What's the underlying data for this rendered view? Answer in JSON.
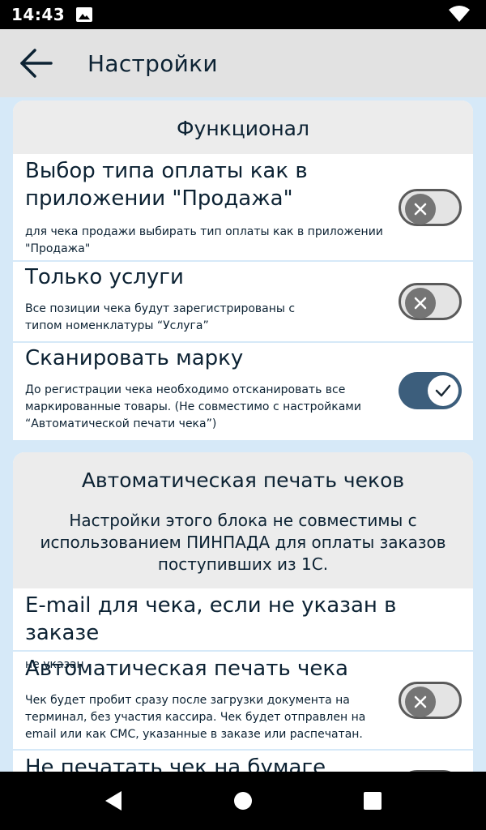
{
  "status": {
    "time": "14:43"
  },
  "app_bar": {
    "title": "Настройки"
  },
  "card1": {
    "title": "Функционал",
    "rows": [
      {
        "title": "Выбор типа оплаты как в приложении \"Продажа\"",
        "desc": "для чека продажи выбирать тип оплаты как в приложении \"Продажа\"",
        "enabled": false
      },
      {
        "title": "Только услуги",
        "desc": "Все позиции чека будут зарегистрированы с типом номенклатуры “Услуга”",
        "enabled": false
      },
      {
        "title": "Сканировать марку",
        "desc": "До регистрации чека необходимо отсканировать все маркированные товары. (Не совместимо с настройками “Автоматической печати чека”)",
        "enabled": true
      }
    ]
  },
  "card2": {
    "title": "Автоматическая печать чеков",
    "note": "Настройки этого блока не совместимы с использованием ПИНПАДА для оплаты заказов поступивших из 1С.",
    "rows": [
      {
        "title": "E-mail для чека, если не указан в заказе",
        "desc": "не указан"
      },
      {
        "title": "Автоматическая печать чека",
        "desc": "Чек будет пробит сразу после загрузки документа на терминал, без участия кассира. Чек будет отправлен на email или как СМС, указанные в заказе или распечатан.",
        "enabled": false
      },
      {
        "title": "Не печатать чек на бумаге",
        "enabled": false
      }
    ]
  },
  "icons": {
    "back": "arrow-left-icon",
    "toggle_off": "close-icon",
    "toggle_on": "check-icon",
    "nav_back": "triangle-back-icon",
    "nav_home": "circle-home-icon",
    "nav_recents": "square-recents-icon"
  },
  "colors": {
    "background": "#d6e9f8",
    "card_header": "#ececec",
    "app_bar": "#e2e2e2",
    "toggle_on": "#3c5e7c",
    "toggle_off_knob": "#757575",
    "text": "#0c2233"
  }
}
